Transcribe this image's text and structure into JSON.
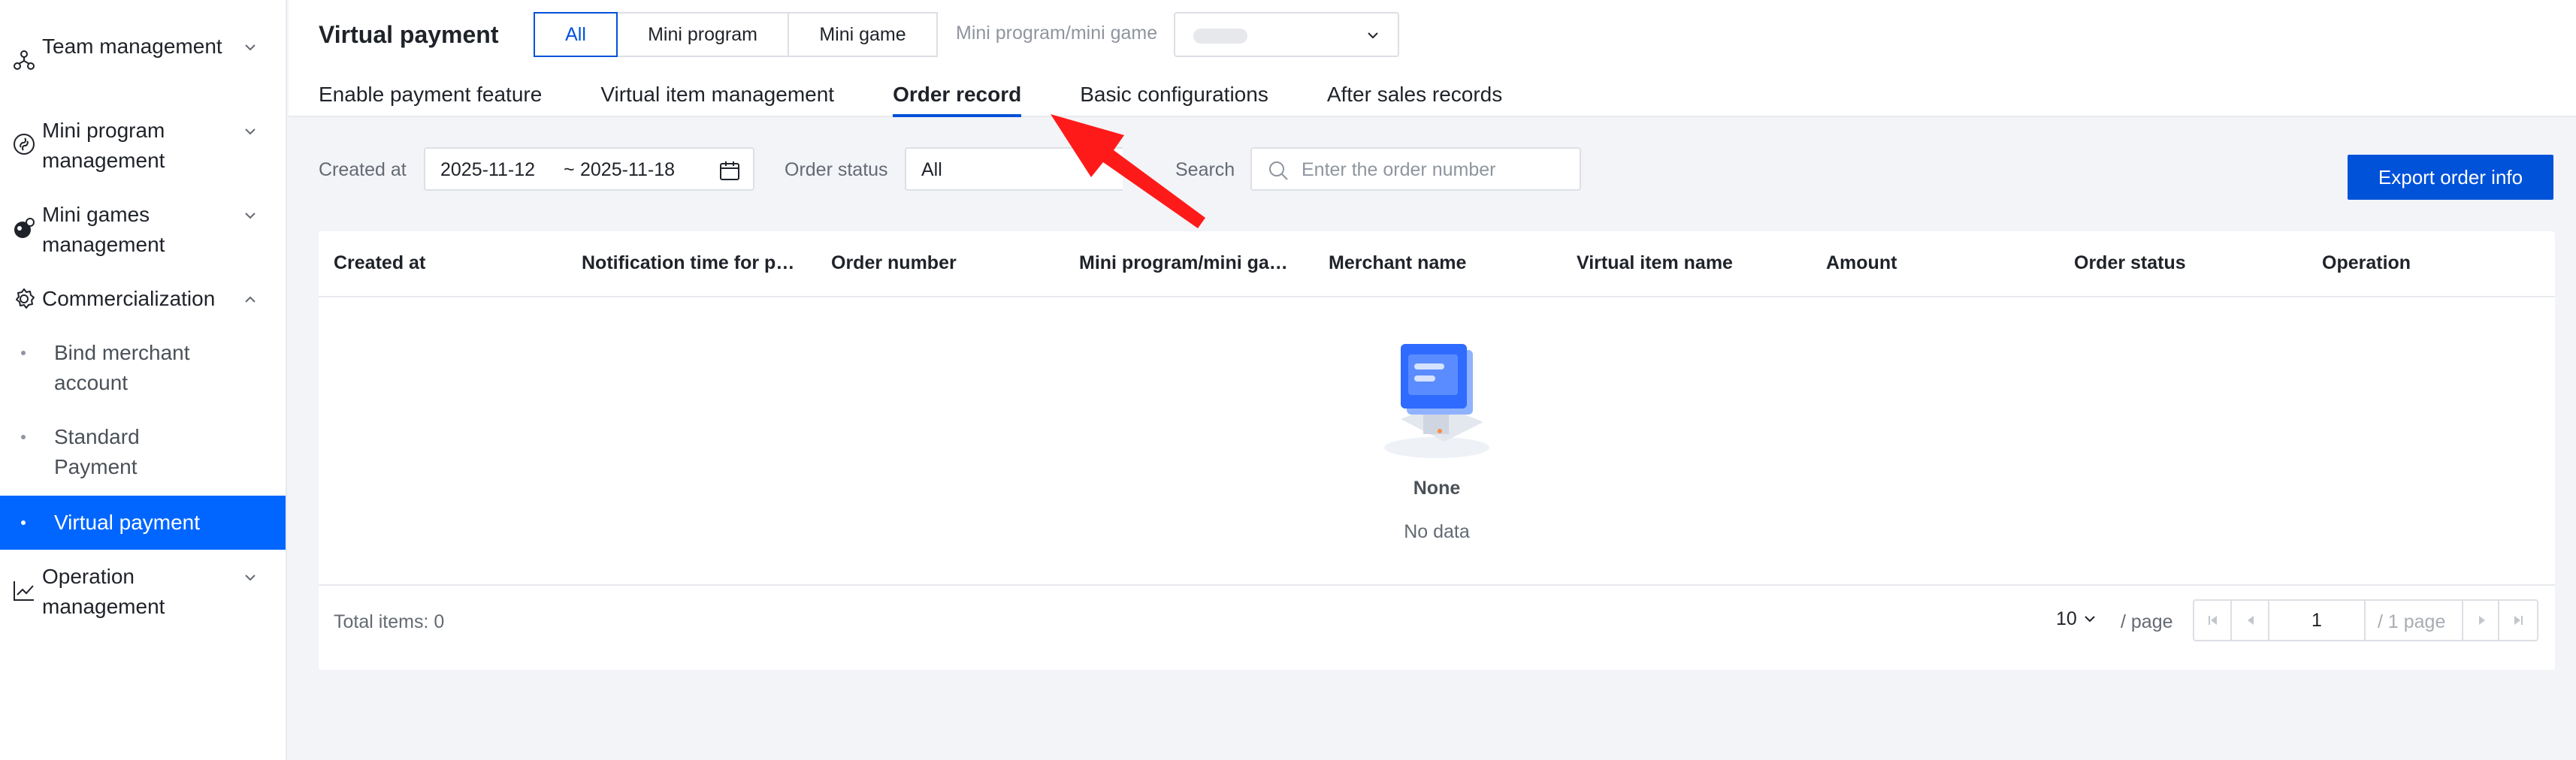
{
  "sidebar": {
    "groups": [
      {
        "label": "Team management",
        "icon": "team-icon"
      },
      {
        "label": "Mini program management",
        "icon": "mini-program-icon"
      },
      {
        "label": "Mini games management",
        "icon": "mini-game-icon"
      },
      {
        "label": "Commercialization",
        "icon": "gear-icon",
        "expanded": true,
        "items": [
          {
            "label": "Bind merchant account"
          },
          {
            "label": "Standard Payment"
          },
          {
            "label": "Virtual payment",
            "active": true
          }
        ]
      },
      {
        "label": "Operation management",
        "icon": "chart-line-icon"
      }
    ]
  },
  "header": {
    "title": "Virtual payment",
    "segments": [
      "All",
      "Mini program",
      "Mini game"
    ],
    "selected_segment": "All",
    "mp_filter_label": "Mini program/mini game",
    "tabs": [
      "Enable payment feature",
      "Virtual item management",
      "Order record",
      "Basic configurations",
      "After sales records"
    ],
    "active_tab": "Order record"
  },
  "filters": {
    "created_label": "Created at",
    "date_start": "2025-11-12",
    "date_sep": "~",
    "date_end": "2025-11-18",
    "status_label": "Order status",
    "status_value": "All",
    "search_label": "Search",
    "search_placeholder": "Enter the order number",
    "export_label": "Export order info"
  },
  "table": {
    "columns": [
      "Created at",
      "Notification time for payment",
      "Order number",
      "Mini program/mini game",
      "Merchant name",
      "Virtual item name",
      "Amount",
      "Order status",
      "Operation"
    ],
    "empty_title": "None",
    "empty_subtitle": "No data"
  },
  "footer": {
    "total": "Total items: 0",
    "page_size": "10",
    "per_page": "/ page",
    "current_page": "1",
    "page_total": "/ 1 page"
  },
  "colors": {
    "primary": "#0052d9",
    "sidebar_active": "#0066ff",
    "annotation": "#ff1a1a"
  }
}
